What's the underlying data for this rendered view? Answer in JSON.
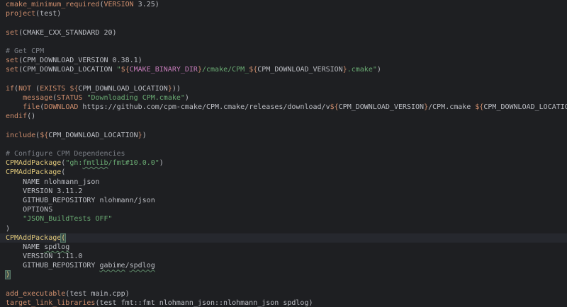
{
  "editor": {
    "language": "CMake",
    "colors": {
      "background": "#1e1f22",
      "current_line": "#26282e",
      "text": "#bcbec4",
      "keyword": "#cf8e6d",
      "string": "#6aab73",
      "comment": "#7a7e85",
      "constant": "#c77dbb",
      "user_function": "#e0c87a"
    },
    "lines": [
      [
        {
          "t": "cmake_minimum_required",
          "c": "fn"
        },
        {
          "t": "(",
          "c": "pun"
        },
        {
          "t": "VERSION",
          "c": "kw"
        },
        {
          "t": " 3.25)",
          "c": "pun"
        }
      ],
      [
        {
          "t": "project",
          "c": "fn"
        },
        {
          "t": "(test)",
          "c": "pun"
        }
      ],
      [],
      [
        {
          "t": "set",
          "c": "fn"
        },
        {
          "t": "(CMAKE_CXX_STANDARD 20)",
          "c": "pun"
        }
      ],
      [],
      [
        {
          "t": "# Get CPM",
          "c": "cmt"
        }
      ],
      [
        {
          "t": "set",
          "c": "fn"
        },
        {
          "t": "(CPM_DOWNLOAD_VERSION 0.38.1)",
          "c": "pun"
        }
      ],
      [
        {
          "t": "set",
          "c": "fn"
        },
        {
          "t": "(CPM_DOWNLOAD_LOCATION ",
          "c": "pun"
        },
        {
          "t": "\"",
          "c": "str"
        },
        {
          "t": "${",
          "c": "kw"
        },
        {
          "t": "CMAKE_BINARY_DIR",
          "c": "const"
        },
        {
          "t": "}",
          "c": "kw"
        },
        {
          "t": "/cmake/CPM_",
          "c": "str"
        },
        {
          "t": "${",
          "c": "kw"
        },
        {
          "t": "CPM_DOWNLOAD_VERSION",
          "c": "var"
        },
        {
          "t": "}",
          "c": "kw"
        },
        {
          "t": ".cmake\"",
          "c": "str"
        },
        {
          "t": ")",
          "c": "pun"
        }
      ],
      [],
      [
        {
          "t": "if",
          "c": "fn"
        },
        {
          "t": "(",
          "c": "pun"
        },
        {
          "t": "NOT",
          "c": "kw"
        },
        {
          "t": " (",
          "c": "pun"
        },
        {
          "t": "EXISTS",
          "c": "kw"
        },
        {
          "t": " ",
          "c": "pun"
        },
        {
          "t": "${",
          "c": "kw"
        },
        {
          "t": "CPM_DOWNLOAD_LOCATION",
          "c": "var"
        },
        {
          "t": "}",
          "c": "kw"
        },
        {
          "t": "))",
          "c": "pun"
        }
      ],
      [
        {
          "t": "    ",
          "c": "pun"
        },
        {
          "t": "message",
          "c": "fn"
        },
        {
          "t": "(",
          "c": "pun"
        },
        {
          "t": "STATUS",
          "c": "kw"
        },
        {
          "t": " ",
          "c": "pun"
        },
        {
          "t": "\"Downloading CPM.cmake\"",
          "c": "str"
        },
        {
          "t": ")",
          "c": "pun"
        }
      ],
      [
        {
          "t": "    ",
          "c": "pun"
        },
        {
          "t": "file",
          "c": "fn"
        },
        {
          "t": "(",
          "c": "pun"
        },
        {
          "t": "DOWNLOAD",
          "c": "kw"
        },
        {
          "t": " https://github.com/cpm-cmake/CPM.cmake/releases/download/v",
          "c": "pun"
        },
        {
          "t": "${",
          "c": "kw"
        },
        {
          "t": "CPM_DOWNLOAD_VERSION",
          "c": "var"
        },
        {
          "t": "}",
          "c": "kw"
        },
        {
          "t": "/CPM.cmake ",
          "c": "pun"
        },
        {
          "t": "${",
          "c": "kw"
        },
        {
          "t": "CPM_DOWNLOAD_LOCATION",
          "c": "var"
        },
        {
          "t": "}",
          "c": "kw"
        },
        {
          "t": ")",
          "c": "pun"
        }
      ],
      [
        {
          "t": "endif",
          "c": "fn"
        },
        {
          "t": "()",
          "c": "pun"
        }
      ],
      [],
      [
        {
          "t": "include",
          "c": "fn"
        },
        {
          "t": "(",
          "c": "pun"
        },
        {
          "t": "${",
          "c": "kw"
        },
        {
          "t": "CPM_DOWNLOAD_LOCATION",
          "c": "var"
        },
        {
          "t": "}",
          "c": "kw"
        },
        {
          "t": ")",
          "c": "pun"
        }
      ],
      [],
      [
        {
          "t": "# Configure CPM Dependencies",
          "c": "cmt"
        }
      ],
      [
        {
          "t": "CPMAddPackage",
          "c": "pkg"
        },
        {
          "t": "(",
          "c": "pun"
        },
        {
          "t": "\"gh:",
          "c": "str"
        },
        {
          "t": "fmtlib",
          "c": "str",
          "typo": true
        },
        {
          "t": "/fmt#10.0.0\"",
          "c": "str"
        },
        {
          "t": ")",
          "c": "pun"
        }
      ],
      [
        {
          "t": "CPMAddPackage",
          "c": "pkg"
        },
        {
          "t": "(",
          "c": "pun"
        }
      ],
      [
        {
          "t": "    NAME nlohmann_json",
          "c": "pun"
        }
      ],
      [
        {
          "t": "    VERSION 3.11.2",
          "c": "pun"
        }
      ],
      [
        {
          "t": "    GITHUB_REPOSITORY nlohmann/json",
          "c": "pun"
        }
      ],
      [
        {
          "t": "    OPTIONS",
          "c": "pun"
        }
      ],
      [
        {
          "t": "    ",
          "c": "pun"
        },
        {
          "t": "\"JSON_BuildTests OFF\"",
          "c": "str"
        }
      ],
      [
        {
          "t": ")",
          "c": "pun"
        }
      ],
      [
        {
          "t": "CPMAddPackage",
          "c": "pkg"
        },
        {
          "t": "(",
          "c": "brk-m"
        }
      ],
      [
        {
          "t": "    NAME ",
          "c": "pun"
        },
        {
          "t": "spdlog",
          "c": "pun",
          "typo": true
        }
      ],
      [
        {
          "t": "    VERSION 1.11.0",
          "c": "pun"
        }
      ],
      [
        {
          "t": "    GITHUB_REPOSITORY ",
          "c": "pun"
        },
        {
          "t": "gabime",
          "c": "pun",
          "typo": true
        },
        {
          "t": "/",
          "c": "pun"
        },
        {
          "t": "spdlog",
          "c": "pun",
          "typo": true
        }
      ],
      [
        {
          "t": ")",
          "c": "brk-m"
        }
      ],
      [],
      [
        {
          "t": "add_executable",
          "c": "fn"
        },
        {
          "t": "(test main.cpp)",
          "c": "pun"
        }
      ],
      [
        {
          "t": "target_link_libraries",
          "c": "fn"
        },
        {
          "t": "(test fmt::fmt nlohmann_json::nlohmann_json ",
          "c": "pun"
        },
        {
          "t": "spdlog",
          "c": "pun",
          "typo": true
        },
        {
          "t": ")",
          "c": "pun"
        }
      ]
    ],
    "current_line_index": 25
  }
}
